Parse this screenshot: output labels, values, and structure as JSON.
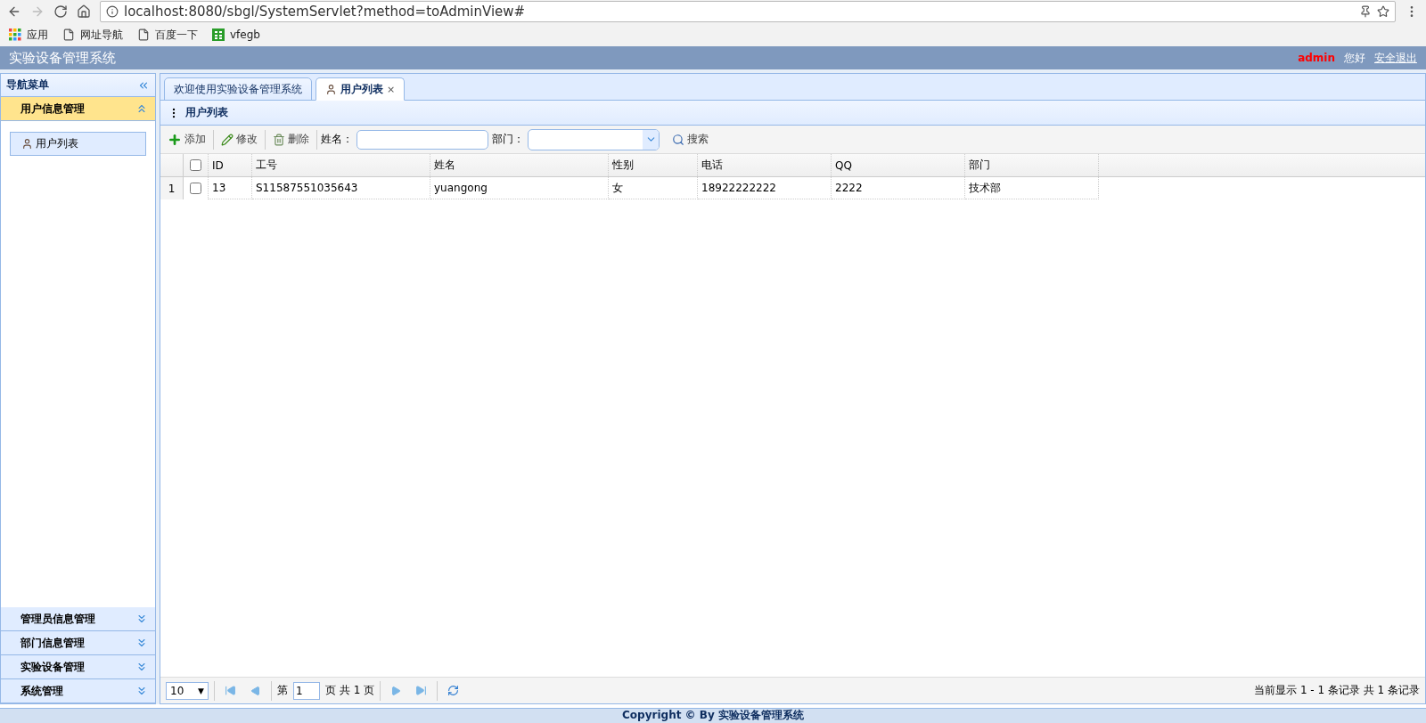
{
  "browser": {
    "url": "localhost:8080/sbgl/SystemServlet?method=toAdminView#",
    "bookmarks": [
      {
        "kind": "apps",
        "label": "应用"
      },
      {
        "kind": "page",
        "label": "网址导航"
      },
      {
        "kind": "page",
        "label": "百度一下"
      },
      {
        "kind": "grid",
        "label": "vfegb"
      }
    ]
  },
  "header": {
    "title": "实验设备管理系统",
    "user": "admin",
    "greeting": "您好",
    "logout": "安全退出"
  },
  "sidebar": {
    "title": "导航菜单",
    "sections": [
      {
        "label": "用户信息管理",
        "expanded": true,
        "items": [
          {
            "label": "用户列表",
            "selected": true
          }
        ]
      },
      {
        "label": "管理员信息管理",
        "expanded": false
      },
      {
        "label": "部门信息管理",
        "expanded": false
      },
      {
        "label": "实验设备管理",
        "expanded": false
      },
      {
        "label": "系统管理",
        "expanded": false
      }
    ]
  },
  "tabs": [
    {
      "label": "欢迎使用实验设备管理系统",
      "selected": false,
      "closable": false
    },
    {
      "label": "用户列表",
      "selected": true,
      "closable": true,
      "close": "×"
    }
  ],
  "panel": {
    "title": "用户列表"
  },
  "toolbar": {
    "buttons": [
      {
        "kind": "add",
        "label": "添加"
      },
      {
        "kind": "edit",
        "label": "修改"
      },
      {
        "kind": "delete",
        "label": "删除"
      }
    ],
    "name_label": "姓名：",
    "dept_label": "部门：",
    "search": "搜索"
  },
  "table": {
    "columns": [
      "ID",
      "工号",
      "姓名",
      "性别",
      "电话",
      "QQ",
      "部门"
    ],
    "all_checked": false,
    "rows": [
      {
        "number": "1",
        "checked": false,
        "cells": [
          "13",
          "S11587551035643",
          "yuangong",
          "女",
          "18922222222",
          "2222",
          "技术部"
        ]
      }
    ]
  },
  "pager": {
    "page_size": "10",
    "arrow": "▼",
    "before": "第",
    "page": "1",
    "after": "页 共 1 页",
    "summary": "当前显示 1 - 1 条记录 共 1 条记录"
  },
  "footer": {
    "text": "Copyright © By 实验设备管理系统"
  }
}
